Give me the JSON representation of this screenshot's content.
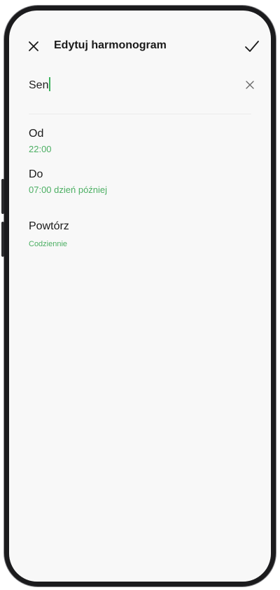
{
  "header": {
    "title": "Edytuj harmonogram",
    "close_icon": "close-icon",
    "confirm_icon": "check-icon"
  },
  "name_field": {
    "value": "Sen",
    "clear_icon": "clear-icon"
  },
  "schedule": {
    "from": {
      "label": "Od",
      "value": "22:00"
    },
    "to": {
      "label": "Do",
      "value": "07:00 dzień później"
    },
    "repeat": {
      "label": "Powtórz",
      "value": "Codziennie"
    }
  },
  "colors": {
    "accent": "#4caf63",
    "cursor": "#3bb35c",
    "background": "#f8f8f8",
    "frame": "#1b1b1d"
  }
}
